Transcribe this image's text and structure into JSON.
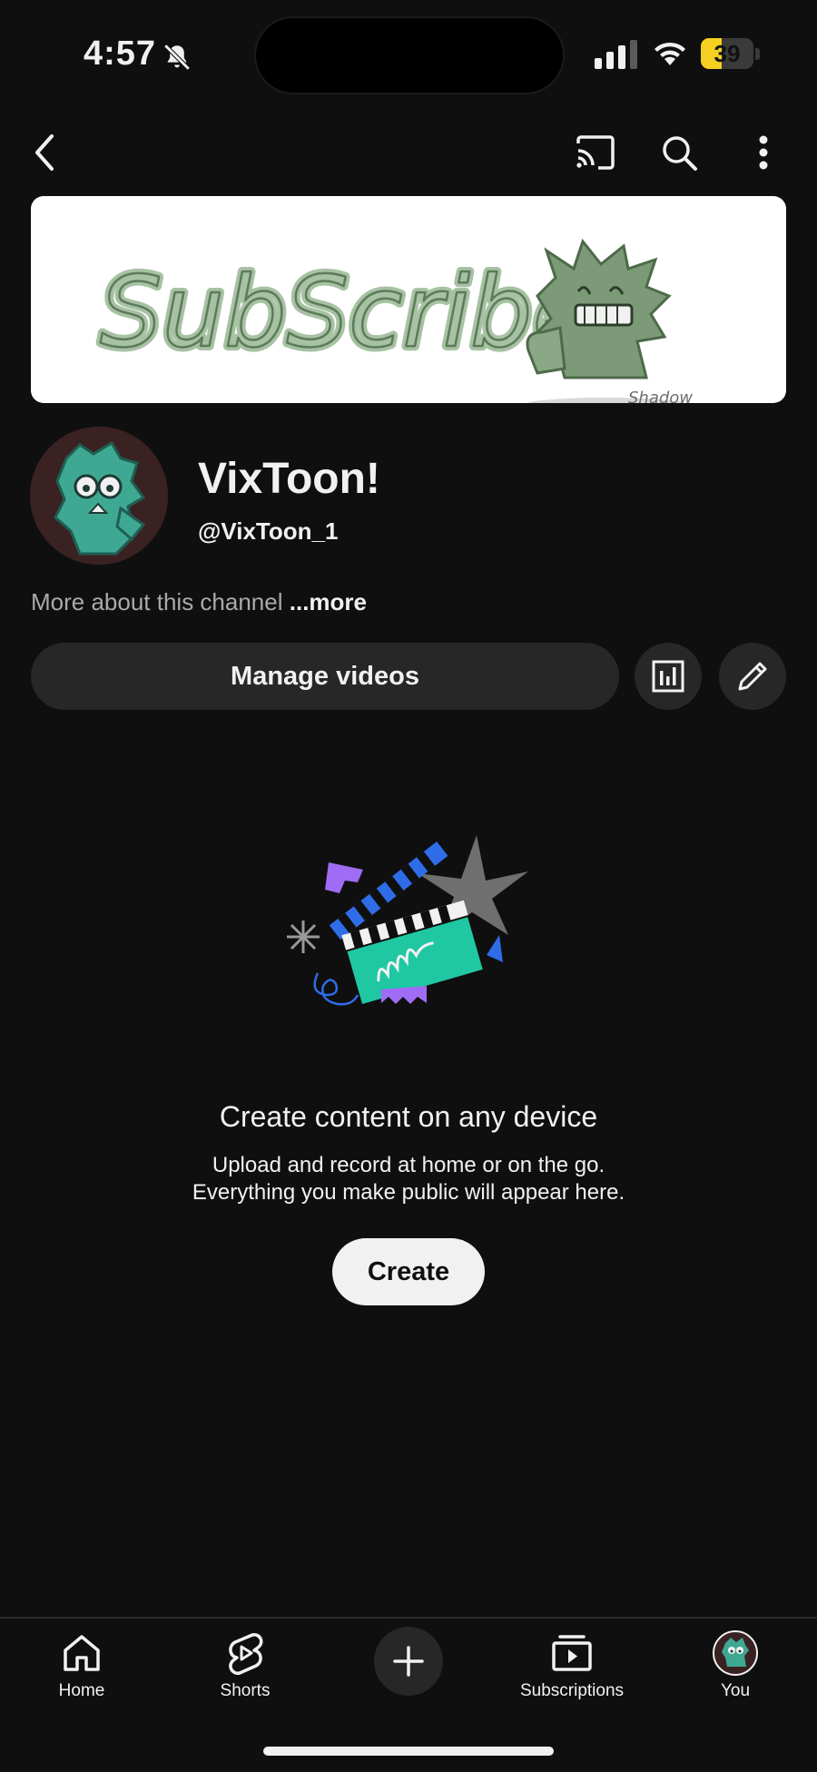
{
  "status_bar": {
    "time": "4:57",
    "battery": "39",
    "battery_level_percent": 39,
    "icons": [
      "bell-slash-icon",
      "cellular-signal-icon",
      "wifi-icon",
      "battery-icon"
    ]
  },
  "top_bar": {
    "icons": [
      "back-icon",
      "cast-icon",
      "search-icon",
      "more-vertical-icon"
    ]
  },
  "banner": {
    "text": "SubScribe",
    "signature": "Shadow"
  },
  "channel": {
    "name": "VixToon!",
    "handle": "@VixToon_1",
    "about": "More about this channel",
    "more": "...more"
  },
  "actions": {
    "manage_videos": "Manage videos",
    "icons": [
      "analytics-icon",
      "edit-pencil-icon"
    ]
  },
  "empty_state": {
    "title": "Create content on any device",
    "line1": "Upload and record at home or on the go.",
    "line2": "Everything you make public will appear here.",
    "create_button": "Create"
  },
  "bottom_nav": {
    "items": [
      {
        "label": "Home",
        "icon": "home-icon"
      },
      {
        "label": "Shorts",
        "icon": "shorts-icon"
      },
      {
        "label": "",
        "icon": "plus-icon"
      },
      {
        "label": "Subscriptions",
        "icon": "subscriptions-icon"
      },
      {
        "label": "You",
        "icon": "avatar"
      }
    ]
  },
  "colors": {
    "background": "#0f0f0f",
    "surface": "#272727",
    "text": "#f1f1f1",
    "secondary_text": "#aaaaaa",
    "battery_yellow": "#f5d020",
    "teal": "#1fc8a3"
  }
}
